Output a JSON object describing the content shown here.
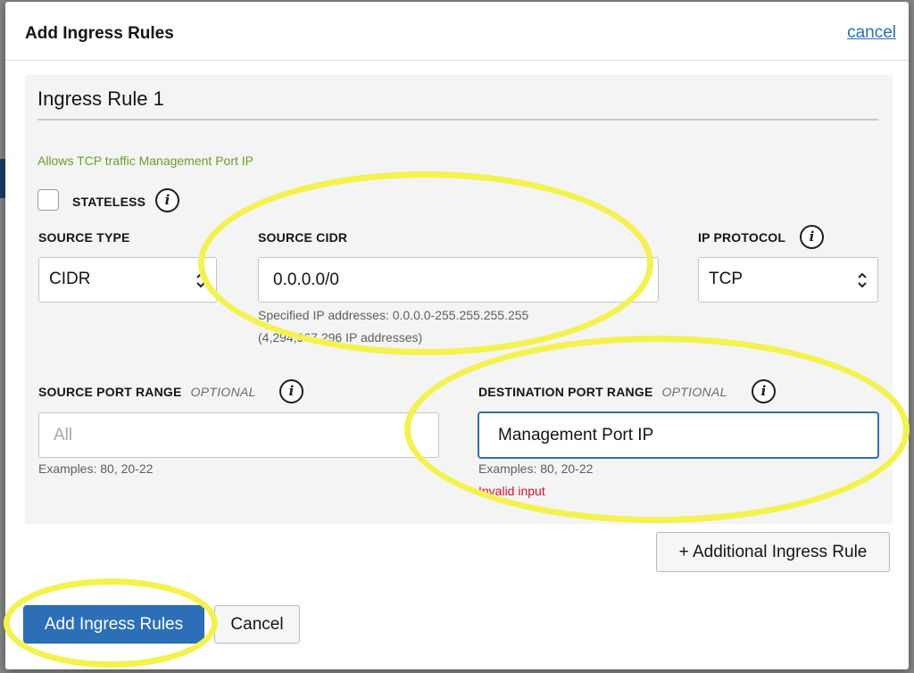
{
  "dialog": {
    "title": "Add Ingress Rules",
    "cancel_link": "cancel"
  },
  "rule": {
    "title": "Ingress Rule 1",
    "description": "Allows TCP traffic Management Port IP",
    "stateless": {
      "label": "STATELESS",
      "checked": false
    },
    "source_type": {
      "label": "SOURCE TYPE",
      "value": "CIDR"
    },
    "source_cidr": {
      "label": "SOURCE CIDR",
      "value": "0.0.0.0/0",
      "hint_line1": "Specified IP addresses: 0.0.0.0-255.255.255.255",
      "hint_line2": "(4,294,967,296 IP addresses)"
    },
    "ip_protocol": {
      "label": "IP PROTOCOL",
      "value": "TCP"
    },
    "source_port_range": {
      "label": "SOURCE PORT RANGE",
      "optional": "OPTIONAL",
      "placeholder": "All",
      "hint": "Examples: 80, 20-22"
    },
    "destination_port_range": {
      "label": "DESTINATION PORT RANGE",
      "optional": "OPTIONAL",
      "value": "Management Port IP",
      "hint": "Examples: 80, 20-22",
      "error": "Invalid input"
    }
  },
  "buttons": {
    "additional_rule": "+ Additional Ingress Rule",
    "submit": "Add Ingress Rules",
    "cancel": "Cancel"
  },
  "colors": {
    "accent_blue": "#2d6fb7",
    "description_green": "#6a9f2b",
    "error_red": "#d0132b",
    "annotation_yellow": "#f3f24e"
  },
  "icons": [
    "info-icon",
    "select-arrows-icon",
    "checkbox-icon"
  ]
}
